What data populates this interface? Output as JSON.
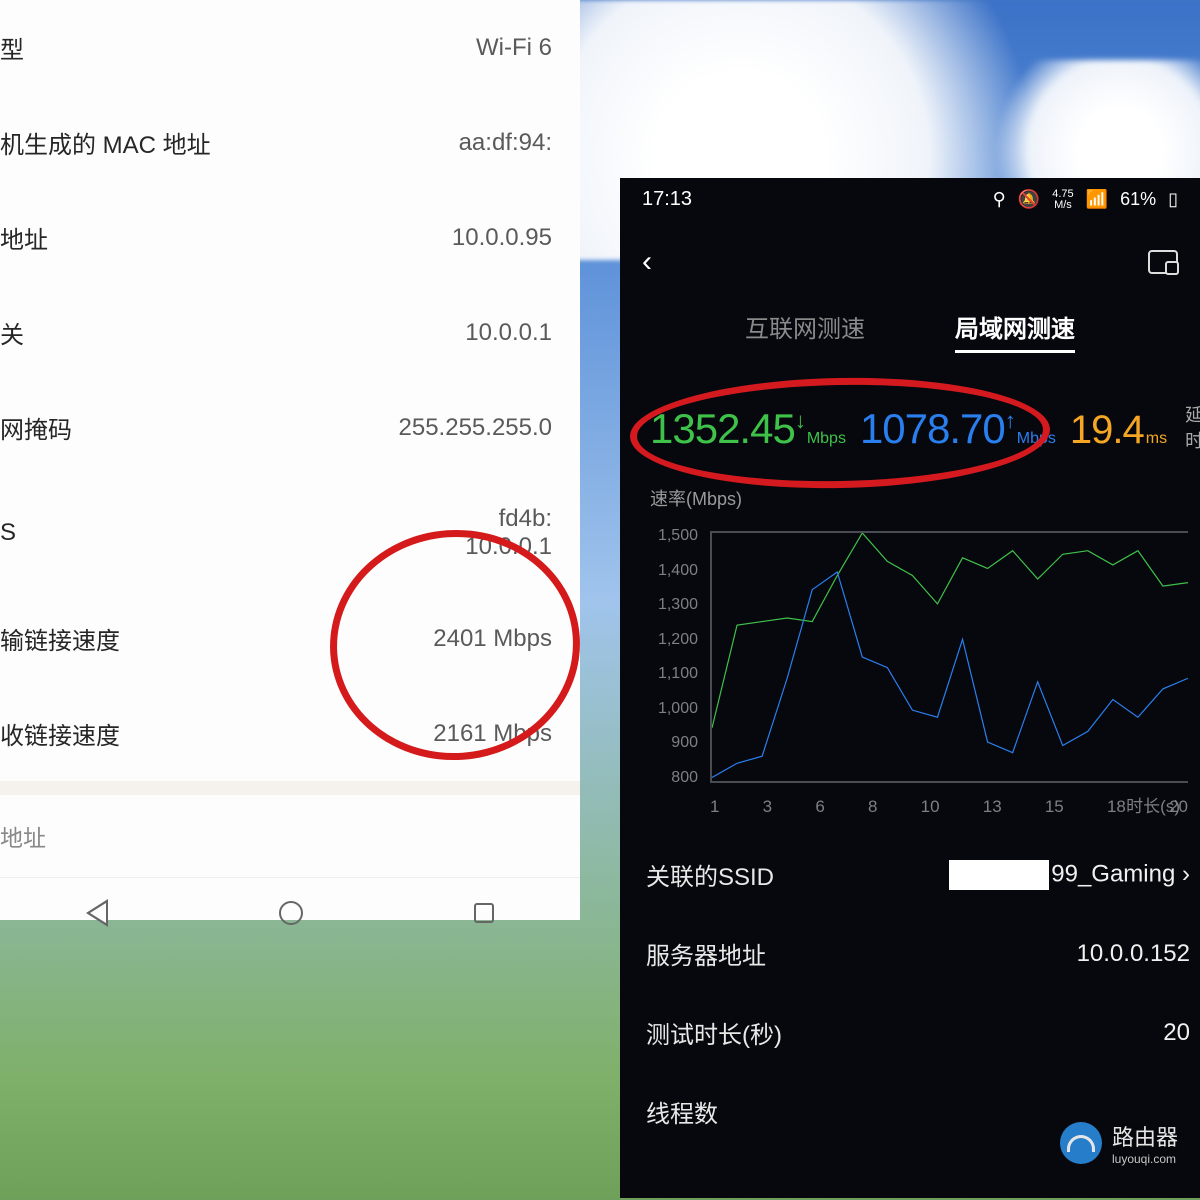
{
  "left": {
    "rows": [
      {
        "label": "型",
        "value": "Wi-Fi 6"
      },
      {
        "label": "机生成的 MAC 地址",
        "value": "aa:df:94:"
      },
      {
        "label": "地址",
        "value": "10.0.0.95"
      },
      {
        "label": "关",
        "value": "10.0.0.1"
      },
      {
        "label": "网掩码",
        "value": "255.255.255.0"
      }
    ],
    "dns": {
      "label": "S",
      "value1": "fd4b:",
      "value2": "10.0.0.1"
    },
    "tx": {
      "label": "输链接速度",
      "value": "2401 Mbps"
    },
    "rx": {
      "label": "收链接速度",
      "value": "2161 Mbps"
    },
    "heading": "地址"
  },
  "right": {
    "status": {
      "time": "17:13",
      "speed_top": "4.75",
      "speed_bot": "M/s",
      "battery": "61%"
    },
    "tabs": {
      "internet": "互联网测速",
      "lan": "局域网测速"
    },
    "metrics": {
      "dl_val": "1352.45",
      "dl_unit": "Mbps",
      "ul_val": "1078.70",
      "ul_unit": "Mbps",
      "lat_val": "19.4",
      "lat_unit": "ms",
      "lat_label": "延时"
    },
    "chart_label": "速率(Mbps)",
    "x_label": "时长(s)",
    "info": {
      "ssid_label": "关联的SSID",
      "ssid_value": "99_Gaming",
      "server_label": "服务器地址",
      "server_value": "10.0.0.152",
      "dur_label": "测试时长(秒)",
      "dur_value": "20",
      "threads_label": "线程数"
    }
  },
  "watermark": {
    "title": "路由器",
    "sub": "luyouqi.com"
  },
  "chart_data": {
    "type": "line",
    "xlabel": "时长(s)",
    "ylabel": "速率(Mbps)",
    "ylim": [
      800,
      1500
    ],
    "x": [
      1,
      2,
      3,
      4,
      5,
      6,
      7,
      8,
      9,
      10,
      11,
      12,
      13,
      14,
      15,
      16,
      17,
      18,
      19,
      20
    ],
    "series": [
      {
        "name": "download",
        "color": "#3fc24a",
        "values": [
          950,
          1240,
          1250,
          1260,
          1250,
          1380,
          1500,
          1420,
          1380,
          1300,
          1430,
          1400,
          1450,
          1370,
          1440,
          1450,
          1410,
          1450,
          1350,
          1360
        ]
      },
      {
        "name": "upload",
        "color": "#2a7fef",
        "values": [
          810,
          850,
          870,
          1090,
          1340,
          1390,
          1150,
          1120,
          1000,
          980,
          1200,
          910,
          880,
          1080,
          900,
          940,
          1030,
          980,
          1060,
          1090
        ]
      }
    ],
    "x_ticks": [
      1,
      3,
      6,
      8,
      10,
      13,
      15,
      18,
      20
    ],
    "y_ticks": [
      1500,
      1400,
      1300,
      1200,
      1100,
      1000,
      900,
      800
    ]
  }
}
